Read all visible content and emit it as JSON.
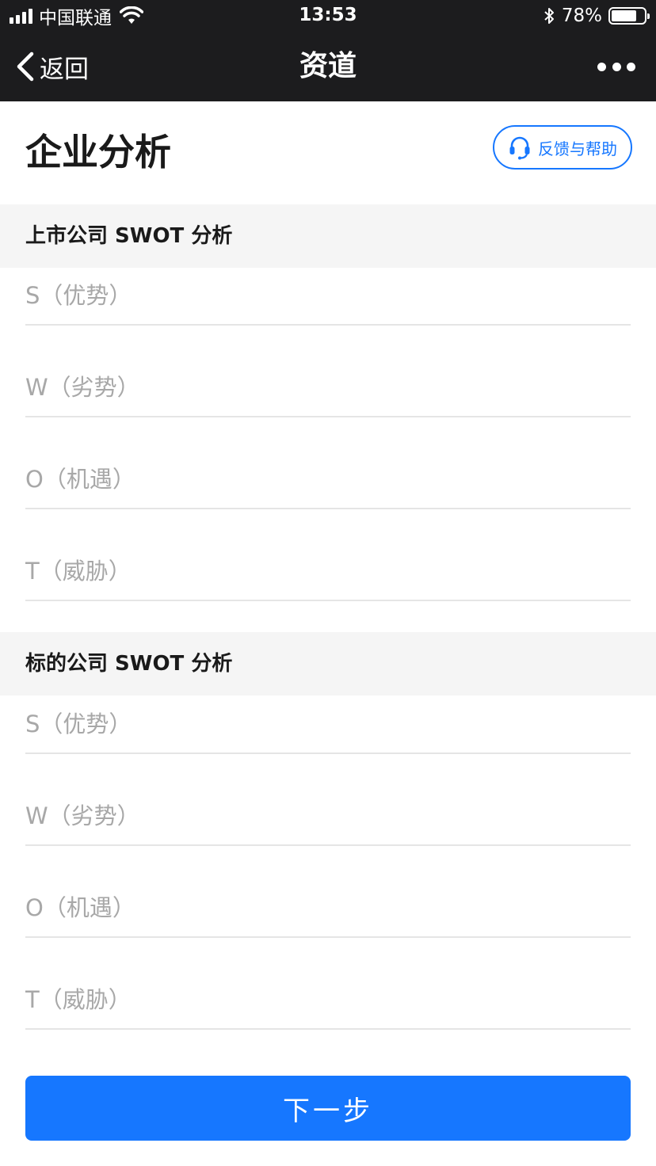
{
  "status_bar": {
    "carrier": "中国联通",
    "time": "13:53",
    "battery": "78%",
    "battery_level": 0.78
  },
  "nav": {
    "back_label": "返回",
    "title": "资道"
  },
  "page": {
    "title": "企业分析",
    "help_label": "反馈与帮助"
  },
  "sections": [
    {
      "title": "上市公司 SWOT 分析",
      "fields": [
        {
          "placeholder": "S（优势）",
          "value": ""
        },
        {
          "placeholder": "W（劣势）",
          "value": ""
        },
        {
          "placeholder": "O（机遇）",
          "value": ""
        },
        {
          "placeholder": "T（威胁）",
          "value": ""
        }
      ]
    },
    {
      "title": "标的公司 SWOT 分析",
      "fields": [
        {
          "placeholder": "S（优势）",
          "value": ""
        },
        {
          "placeholder": "W（劣势）",
          "value": ""
        },
        {
          "placeholder": "O（机遇）",
          "value": ""
        },
        {
          "placeholder": "T（威胁）",
          "value": ""
        }
      ]
    }
  ],
  "footer": {
    "next_label": "下一步"
  },
  "colors": {
    "accent": "#1677ff",
    "bar": "#1c1c1e",
    "section_bg": "#f5f5f5",
    "placeholder": "#a8a8a8"
  }
}
